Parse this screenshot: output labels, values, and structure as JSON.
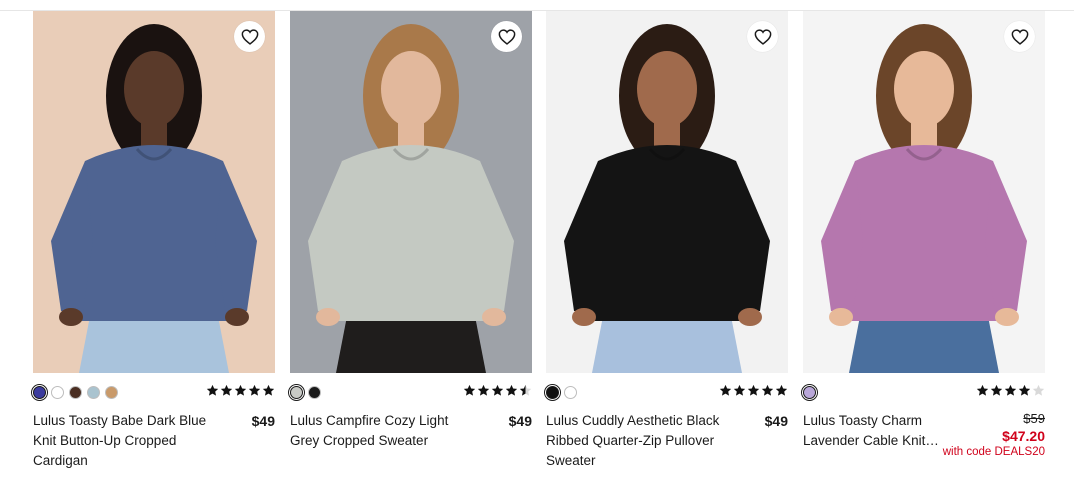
{
  "products": [
    {
      "name": "Lulus Toasty Babe Dark Blue Knit Button-Up Cropped Cardigan",
      "price": "$49",
      "rating": 5,
      "swatches": [
        "#3b3b9e",
        "#ffffff",
        "#4a2e22",
        "#a9c3cf",
        "#c99a6a"
      ],
      "selected_swatch": 0,
      "image": {
        "bg": "#e9cdb8",
        "garment": "#4f6492",
        "skin": "#5a3a2a",
        "hair": "#1a1210",
        "bottom": "#a9c3dc"
      }
    },
    {
      "name": "Lulus Campfire Cozy Light Grey Cropped Sweater",
      "price": "$49",
      "rating": 4.5,
      "swatches": [
        "#c8cac6",
        "#1a1a1a"
      ],
      "selected_swatch": 0,
      "image": {
        "bg": "#9ea2a8",
        "garment": "#c4c9c2",
        "skin": "#e2b89c",
        "hair": "#a9794a",
        "bottom": "#1f1d1c"
      }
    },
    {
      "name": "Lulus Cuddly Aesthetic Black Ribbed Quarter-Zip Pullover Sweater",
      "price": "$49",
      "rating": 5,
      "swatches": [
        "#111111",
        "#ffffff"
      ],
      "selected_swatch": 0,
      "image": {
        "bg": "#f2f2f2",
        "garment": "#141414",
        "skin": "#a06a4c",
        "hair": "#2b1c14",
        "bottom": "#a8c0dd"
      }
    },
    {
      "name": "Lulus Toasty Charm Lavender Cable Knit Sweater",
      "old_price": "$59",
      "sale_price": "$47.20",
      "promo": "with code DEALS20",
      "rating": 4,
      "swatches": [
        "#b9a7d9"
      ],
      "selected_swatch": 0,
      "image": {
        "bg": "#f4f4f4",
        "garment": "#b577ae",
        "skin": "#e7b999",
        "hair": "#6b4529",
        "bottom": "#4a6f9e"
      }
    }
  ]
}
